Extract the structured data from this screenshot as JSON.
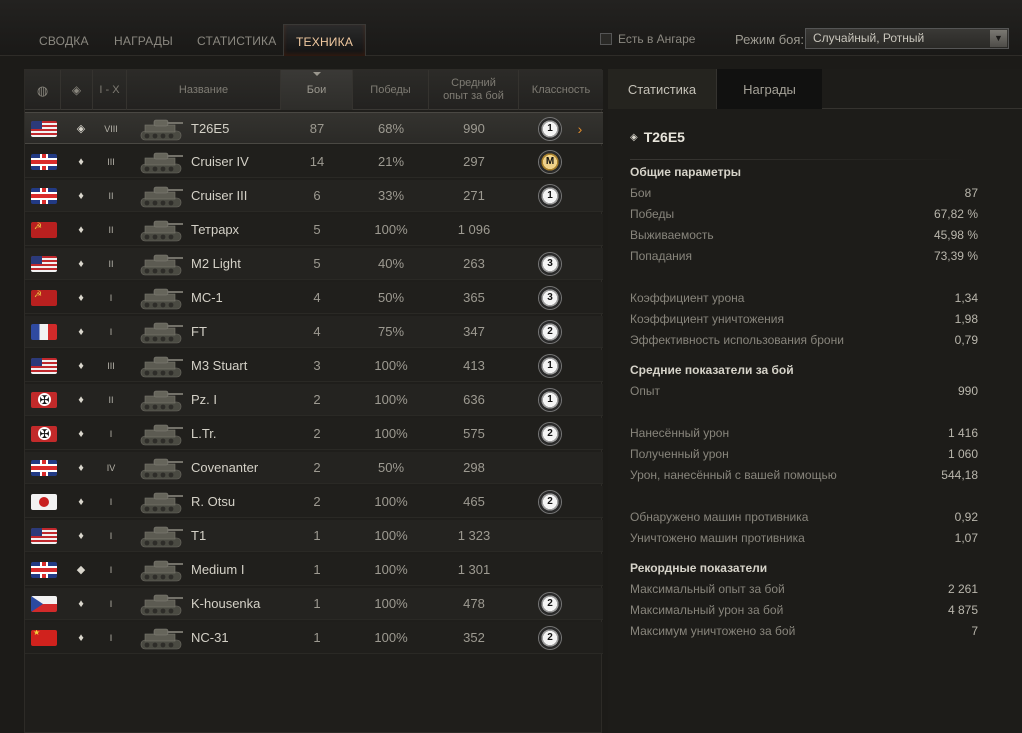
{
  "tabs": [
    "Сводка",
    "Награды",
    "Статистика",
    "Техника"
  ],
  "hangar_checkbox_label": "Есть в Ангаре",
  "battle_mode_label": "Режим боя:",
  "battle_mode_value": "Случайный, Ротный",
  "table": {
    "headers": {
      "tier_range": "I - X",
      "name": "Название",
      "battles": "Бои",
      "wins": "Победы",
      "avg_xp_line1": "Средний",
      "avg_xp_line2": "опыт за бой",
      "mastery": "Классность"
    },
    "rows": [
      {
        "nation": "usa",
        "type": "heavy",
        "tier": "VIII",
        "name": "T26E5",
        "battles": "87",
        "wins": "68%",
        "xp": "990",
        "badge": "1"
      },
      {
        "nation": "uk",
        "type": "light",
        "tier": "III",
        "name": "Cruiser IV",
        "battles": "14",
        "wins": "21%",
        "xp": "297",
        "badge": "M"
      },
      {
        "nation": "uk",
        "type": "light",
        "tier": "II",
        "name": "Cruiser III",
        "battles": "6",
        "wins": "33%",
        "xp": "271",
        "badge": "1"
      },
      {
        "nation": "ussr",
        "type": "light",
        "tier": "II",
        "name": "Тетрарх",
        "battles": "5",
        "wins": "100%",
        "xp": "1 096",
        "badge": ""
      },
      {
        "nation": "usa",
        "type": "light",
        "tier": "II",
        "name": "M2 Light",
        "battles": "5",
        "wins": "40%",
        "xp": "263",
        "badge": "3"
      },
      {
        "nation": "ussr",
        "type": "light",
        "tier": "I",
        "name": "MC-1",
        "battles": "4",
        "wins": "50%",
        "xp": "365",
        "badge": "3"
      },
      {
        "nation": "fr",
        "type": "light",
        "tier": "I",
        "name": "FT",
        "battles": "4",
        "wins": "75%",
        "xp": "347",
        "badge": "2"
      },
      {
        "nation": "usa",
        "type": "light",
        "tier": "III",
        "name": "M3 Stuart",
        "battles": "3",
        "wins": "100%",
        "xp": "413",
        "badge": "1"
      },
      {
        "nation": "de",
        "type": "light",
        "tier": "II",
        "name": "Pz. I",
        "battles": "2",
        "wins": "100%",
        "xp": "636",
        "badge": "1"
      },
      {
        "nation": "de",
        "type": "light",
        "tier": "I",
        "name": "L.Tr.",
        "battles": "2",
        "wins": "100%",
        "xp": "575",
        "badge": "2"
      },
      {
        "nation": "uk",
        "type": "light",
        "tier": "IV",
        "name": "Covenanter",
        "battles": "2",
        "wins": "50%",
        "xp": "298",
        "badge": ""
      },
      {
        "nation": "jp",
        "type": "light",
        "tier": "I",
        "name": "R. Otsu",
        "battles": "2",
        "wins": "100%",
        "xp": "465",
        "badge": "2"
      },
      {
        "nation": "usa",
        "type": "light",
        "tier": "I",
        "name": "T1",
        "battles": "1",
        "wins": "100%",
        "xp": "1 323",
        "badge": ""
      },
      {
        "nation": "uk",
        "type": "medium",
        "tier": "I",
        "name": "Medium I",
        "battles": "1",
        "wins": "100%",
        "xp": "1 301",
        "badge": ""
      },
      {
        "nation": "cz",
        "type": "light",
        "tier": "I",
        "name": "K-housenka",
        "battles": "1",
        "wins": "100%",
        "xp": "478",
        "badge": "2"
      },
      {
        "nation": "cn",
        "type": "light",
        "tier": "I",
        "name": "NC-31",
        "battles": "1",
        "wins": "100%",
        "xp": "352",
        "badge": "2"
      }
    ]
  },
  "panel": {
    "tabs": [
      "Статистика",
      "Награды"
    ],
    "title": "T26E5",
    "sections": [
      {
        "heading": "Общие параметры",
        "stats": [
          [
            "Бои",
            "87"
          ],
          [
            "Победы",
            "67,82 %"
          ],
          [
            "Выживаемость",
            "45,98 %"
          ],
          [
            "Попадания",
            "73,39 %"
          ],
          [
            "",
            ""
          ],
          [
            "Коэффициент урона",
            "1,34"
          ],
          [
            "Коэффициент уничтожения",
            "1,98"
          ],
          [
            "Эффективность использования брони",
            "0,79"
          ]
        ]
      },
      {
        "heading": "Средние показатели за бой",
        "stats": [
          [
            "Опыт",
            "990"
          ],
          [
            "",
            ""
          ],
          [
            "Нанесённый урон",
            "1 416"
          ],
          [
            "Полученный урон",
            "1 060"
          ],
          [
            "Урон, нанесённый с вашей помощью",
            "544,18"
          ],
          [
            "",
            ""
          ],
          [
            "Обнаружено машин противника",
            "0,92"
          ],
          [
            "Уничтожено машин противника",
            "1,07"
          ]
        ]
      },
      {
        "heading": "Рекордные показатели",
        "stats": [
          [
            "Максимальный опыт за бой",
            "2 261"
          ],
          [
            "Максимальный урон за бой",
            "4 875"
          ],
          [
            "Максимум уничтожено за бой",
            "7"
          ]
        ]
      }
    ]
  }
}
